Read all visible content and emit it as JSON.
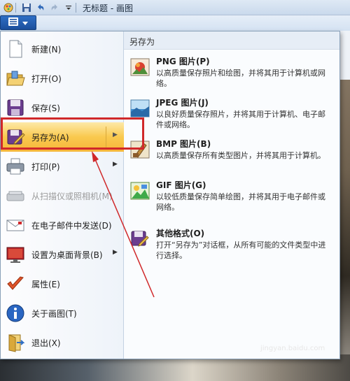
{
  "titlebar": {
    "title": "无标题 - 画图"
  },
  "menu": {
    "items": [
      {
        "label": "新建(N)"
      },
      {
        "label": "打开(O)"
      },
      {
        "label": "保存(S)"
      },
      {
        "label": "另存为(A)"
      },
      {
        "label": "打印(P)"
      },
      {
        "label": "从扫描仪或照相机(M)"
      },
      {
        "label": "在电子邮件中发送(D)"
      },
      {
        "label": "设置为桌面背景(B)"
      },
      {
        "label": "属性(E)"
      },
      {
        "label": "关于画图(T)"
      },
      {
        "label": "退出(X)"
      }
    ]
  },
  "saveas": {
    "header": "另存为",
    "options": [
      {
        "title": "PNG 图片(P)",
        "desc": "以高质量保存照片和绘图，并将其用于计算机或网络。"
      },
      {
        "title": "JPEG 图片(J)",
        "desc": "以良好质量保存照片，并将其用于计算机、电子邮件或网络。"
      },
      {
        "title": "BMP 图片(B)",
        "desc": "以高质量保存所有类型图片，并将其用于计算机。"
      },
      {
        "title": "GIF 图片(G)",
        "desc": "以较低质量保存简单绘图，并将其用于电子邮件或网络。"
      },
      {
        "title": "其他格式(O)",
        "desc": "打开“另存为”对话框，从所有可能的文件类型中进行选择。"
      }
    ]
  },
  "colors": {
    "highlight": "#f9c94e",
    "annotation": "#d0282a",
    "accent": "#1b4f9c"
  }
}
